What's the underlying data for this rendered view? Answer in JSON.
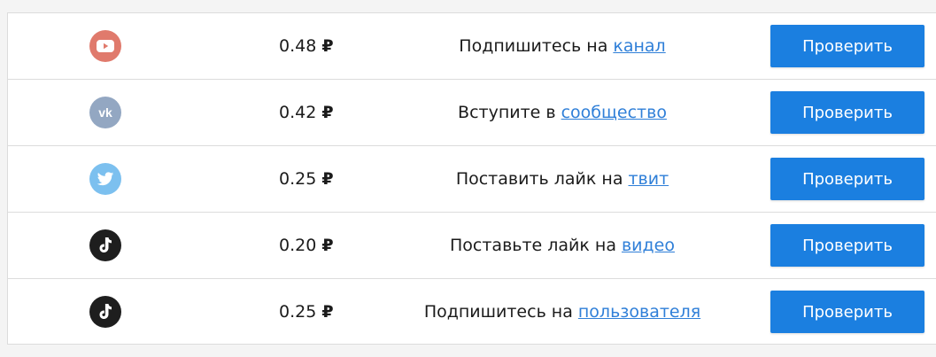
{
  "tasks": [
    {
      "icon": "youtube-icon",
      "icon_color": "#e07a6c",
      "price": "0.48",
      "currency": "₽",
      "text": "Подпишитесь на",
      "link": "канал",
      "button": "Проверить"
    },
    {
      "icon": "vk-icon",
      "icon_color": "#93a7c2",
      "price": "0.42",
      "currency": "₽",
      "text": "Вступите в",
      "link": "сообщество",
      "button": "Проверить"
    },
    {
      "icon": "twitter-icon",
      "icon_color": "#7cc0ef",
      "price": "0.25",
      "currency": "₽",
      "text": "Поставить лайк на",
      "link": "твит",
      "button": "Проверить"
    },
    {
      "icon": "tiktok-icon",
      "icon_color": "#1e1e1e",
      "price": "0.20",
      "currency": "₽",
      "text": "Поставьте лайк на",
      "link": "видео",
      "button": "Проверить"
    },
    {
      "icon": "tiktok-icon",
      "icon_color": "#1e1e1e",
      "price": "0.25",
      "currency": "₽",
      "text": "Подпишитесь на",
      "link": "пользователя",
      "button": "Проверить"
    }
  ],
  "colors": {
    "accent": "#1b7fe0",
    "link": "#2f7fd8"
  }
}
